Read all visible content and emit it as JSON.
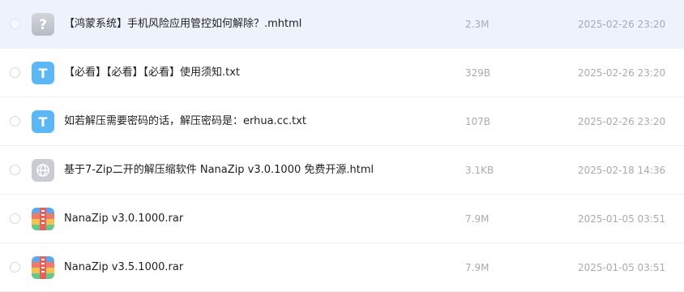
{
  "files": [
    {
      "icon": "unknown-file-icon",
      "name": "【鸿蒙系统】手机风险应用管控如何解除？.mhtml",
      "size": "2.3M",
      "date": "2025-02-26 23:20"
    },
    {
      "icon": "text-file-icon",
      "name": "【必看】【必看】【必看】使用须知.txt",
      "size": "329B",
      "date": "2025-02-26 23:20"
    },
    {
      "icon": "text-file-icon",
      "name": "如若解压需要密码的话，解压密码是：erhua.cc.txt",
      "size": "107B",
      "date": "2025-02-26 23:20"
    },
    {
      "icon": "web-file-icon",
      "name": "基于7-Zip二开的解压缩软件 NanaZip v3.0.1000 免费开源.html",
      "size": "3.1KB",
      "date": "2025-02-18 14:36"
    },
    {
      "icon": "archive-file-icon",
      "name": "NanaZip v3.0.1000.rar",
      "size": "7.9M",
      "date": "2025-01-05 03:51"
    },
    {
      "icon": "archive-file-icon",
      "name": "NanaZip v3.5.1000.rar",
      "size": "7.9M",
      "date": "2025-01-05 03:51"
    }
  ],
  "icon_glyphs": {
    "unknown": "?",
    "text": "T"
  },
  "colors": {
    "selected_row": "#eef2fd",
    "text_icon": "#5cb8f5",
    "unknown_icon": "#c5c8cf",
    "meta_text": "#a8abb2"
  }
}
